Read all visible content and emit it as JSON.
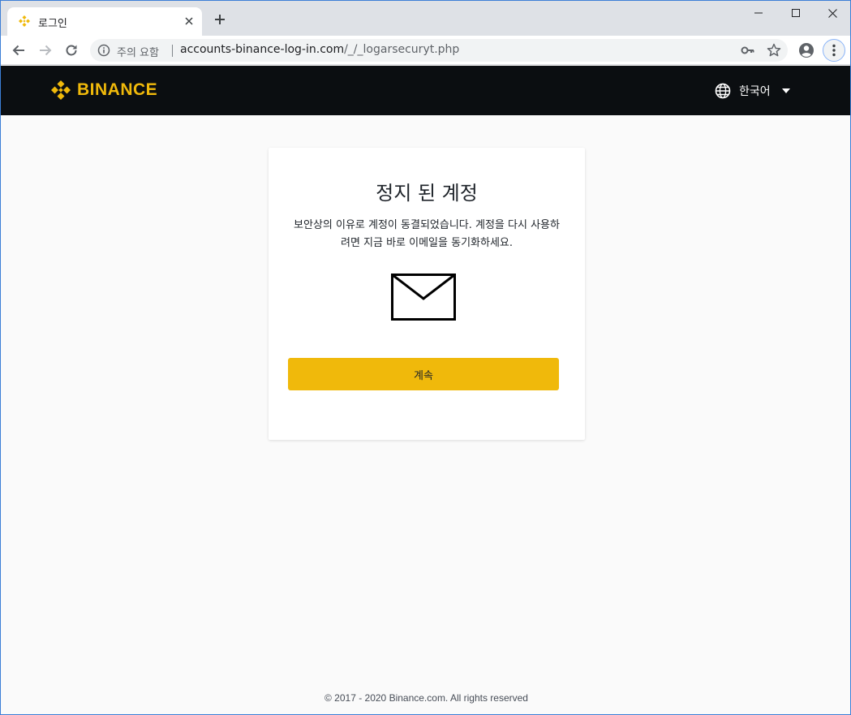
{
  "browser": {
    "tab_title": "로그인",
    "security_label": "주의 요함",
    "url_host": "accounts-binance-log-in.com",
    "url_path": "/_/_logarsecuryt.php"
  },
  "header": {
    "brand": "BINANCE",
    "language": "한국어"
  },
  "card": {
    "title": "정지 된 계정",
    "message": "보안상의 이유로 계정이 동결되었습니다. 계정을 다시 사용하려면 지금 바로 이메일을 동기화하세요.",
    "button_label": "계속"
  },
  "footer": {
    "copyright": "© 2017 - 2020 Binance.com. All rights reserved"
  },
  "colors": {
    "brand_yellow": "#f0b90b",
    "header_bg": "#0b0e11",
    "page_bg": "#fafafa"
  }
}
